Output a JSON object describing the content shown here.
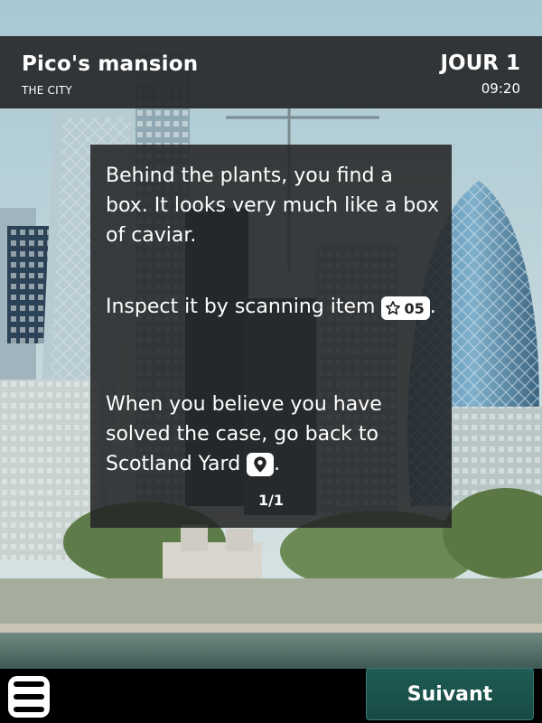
{
  "header": {
    "location": "Pico's mansion",
    "area": "THE CITY",
    "day": "JOUR 1",
    "time": "09:20"
  },
  "dialog": {
    "paragraph1": "Behind the plants, you find a box. It looks very much like a box of caviar.",
    "paragraph2_text": "Inspect it by scanning item",
    "item_code": "05",
    "item_icon": "star-outline-icon",
    "paragraph2_end": ".",
    "paragraph3_text": "When you believe you have solved the case, go back to Scotland Yard",
    "location_icon": "map-pin-icon",
    "paragraph3_end": ".",
    "pager": "1/1"
  },
  "footer": {
    "menu_icon": "hamburger-menu-icon",
    "next_label": "Suivant",
    "next_color": "#1f5b55"
  }
}
